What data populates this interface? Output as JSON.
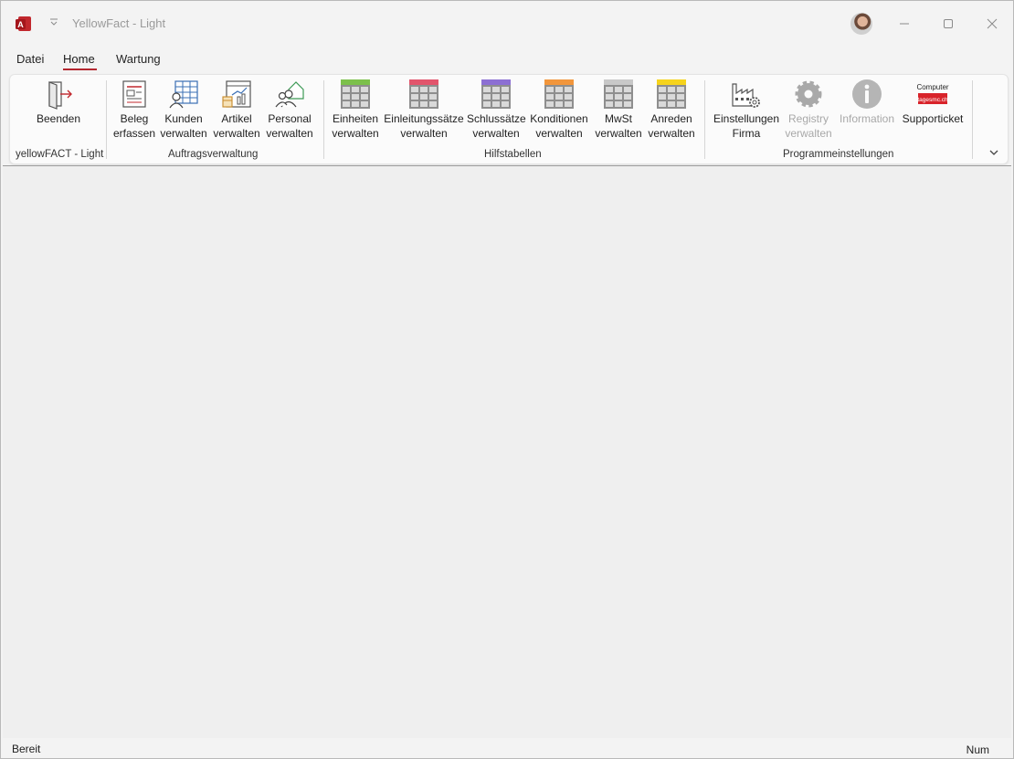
{
  "window": {
    "title": "YellowFact - Light"
  },
  "tabs": [
    {
      "label": "Datei"
    },
    {
      "label": "Home"
    },
    {
      "label": "Wartung"
    }
  ],
  "ribbon": {
    "groups": {
      "yellowfact": "yellowFACT - Light",
      "auftrag": "Auftragsverwaltung",
      "hilfs": "Hilfstabellen",
      "programm": "Programmeinstellungen"
    },
    "buttons": {
      "beenden": [
        "Beenden"
      ],
      "beleg": [
        "Beleg",
        "erfassen"
      ],
      "kunden": [
        "Kunden",
        "verwalten"
      ],
      "artikel": [
        "Artikel",
        "verwalten"
      ],
      "personal": [
        "Personal",
        "verwalten"
      ],
      "einheiten": [
        "Einheiten",
        "verwalten"
      ],
      "einleitung": [
        "Einleitungssätze",
        "verwalten"
      ],
      "schluss": [
        "Schlussätze",
        "verwalten"
      ],
      "konditionen": [
        "Konditionen",
        "verwalten"
      ],
      "mwst": [
        "MwSt",
        "verwalten"
      ],
      "anreden": [
        "Anreden",
        "verwalten"
      ],
      "einstellungen": [
        "Einstellungen",
        "Firma"
      ],
      "registry": [
        "Registry",
        "verwalten"
      ],
      "information": [
        "Information"
      ],
      "supportticket": [
        "Supporticket"
      ]
    },
    "support_logo": {
      "top": "Computer",
      "bottom": "tagesmc.ch"
    },
    "table_colors": {
      "einheiten": "#7cc04b",
      "einleitung": "#e2556c",
      "schluss": "#8c6fd3",
      "konditionen": "#f2963c",
      "mwst": "#c8c8c8",
      "anreden": "#f6d31c"
    }
  },
  "status": {
    "left": "Bereit",
    "right": "Num"
  }
}
